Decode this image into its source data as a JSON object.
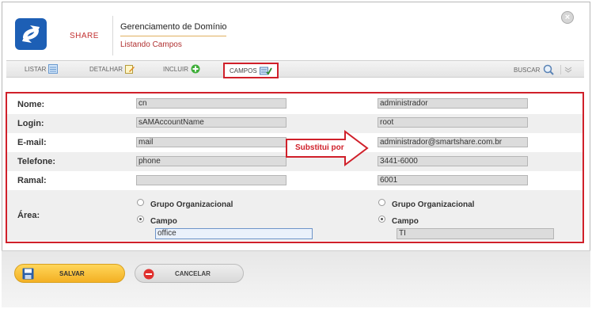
{
  "header": {
    "brand": "SHARE",
    "title": "Gerenciamento de Domínio",
    "subtitle": "Listando Campos"
  },
  "tabs": [
    {
      "label": "LISTAR",
      "icon": "list-icon"
    },
    {
      "label": "DETALHAR",
      "icon": "edit-icon"
    },
    {
      "label": "INCLUIR",
      "icon": "plus-icon"
    },
    {
      "label": "CAMPOS",
      "icon": "fields-icon",
      "active": true
    }
  ],
  "search": {
    "label": "BUSCAR"
  },
  "form": {
    "rows": [
      {
        "label": "Nome:",
        "left": "cn",
        "right": "administrador"
      },
      {
        "label": "Login:",
        "left": "sAMAccountName",
        "right": "root"
      },
      {
        "label": "E-mail:",
        "left": "mail",
        "right": "administrador@smartshare.com.br"
      },
      {
        "label": "Telefone:",
        "left": "phone",
        "right": "3441-6000"
      },
      {
        "label": "Ramal:",
        "left": "",
        "right": "6001"
      }
    ],
    "area": {
      "label": "Área:",
      "option_group": "Grupo Organizacional",
      "option_field": "Campo",
      "left_value": "office",
      "right_value": "TI"
    },
    "annotation": "Substitui por"
  },
  "footer": {
    "save_label": "SALVAR",
    "cancel_label": "CANCELAR"
  },
  "colors": {
    "highlight": "#d0202a",
    "save": "#f3b023",
    "brand_blue": "#1d5fb5"
  }
}
